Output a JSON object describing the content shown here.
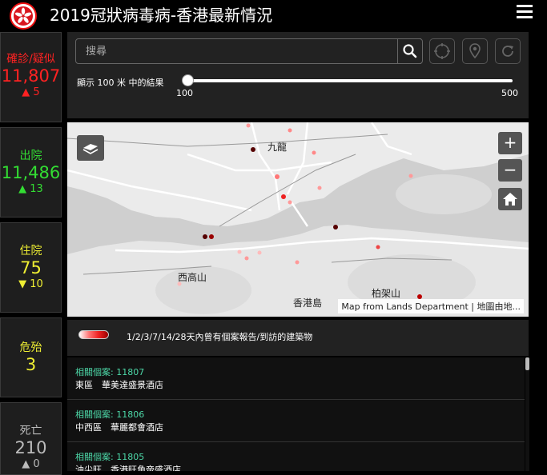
{
  "header": {
    "title": "2019冠狀病毒病-香港最新情況"
  },
  "stats": {
    "confirmed": {
      "label": "確診/疑似",
      "value": "11,807",
      "change": "▲ 5",
      "color": "#ff2222"
    },
    "discharged": {
      "label": "出院",
      "value": "11,486",
      "change": "▲ 13",
      "color": "#33dd33"
    },
    "hospitalised": {
      "label": "住院",
      "value": "75",
      "change": "▼ 10",
      "color": "#eeee33"
    },
    "critical": {
      "label": "危殆",
      "value": "3",
      "change": "",
      "color": "#eeee33"
    },
    "deceased": {
      "label": "死亡",
      "value": "210",
      "change": "▲ 0",
      "color": "#bbbbbb"
    }
  },
  "search": {
    "placeholder": "搜尋",
    "radius_label": "顯示 100 米 中的結果",
    "min_label": "100",
    "max_label": "500",
    "radius_value": 100
  },
  "map": {
    "labels": {
      "kowloon": "九龍",
      "sai_ko_shan": "西高山",
      "hong_kong": "香港島",
      "mount_parker": "柏架山"
    },
    "attribution": "Map from Lands Department | 地圖由地...",
    "zoom_in": "+",
    "zoom_out": "−"
  },
  "legend": {
    "text": "1/2/3/7/14/28天內曾有個案報告/到訪的建築物"
  },
  "cases": [
    {
      "case": "相關個案: 11807",
      "place": "東區　華美達盛景酒店"
    },
    {
      "case": "相關個案: 11806",
      "place": "中西區　華麗都會酒店"
    },
    {
      "case": "相關個案: 11805",
      "place": "油尖旺　香港旺角帝盛酒店"
    }
  ],
  "icons": [
    "hk-emblem-icon",
    "menu-icon",
    "search-icon",
    "crosshair-icon",
    "location-pin-icon",
    "reset-icon",
    "basemap-icon",
    "home-icon"
  ]
}
